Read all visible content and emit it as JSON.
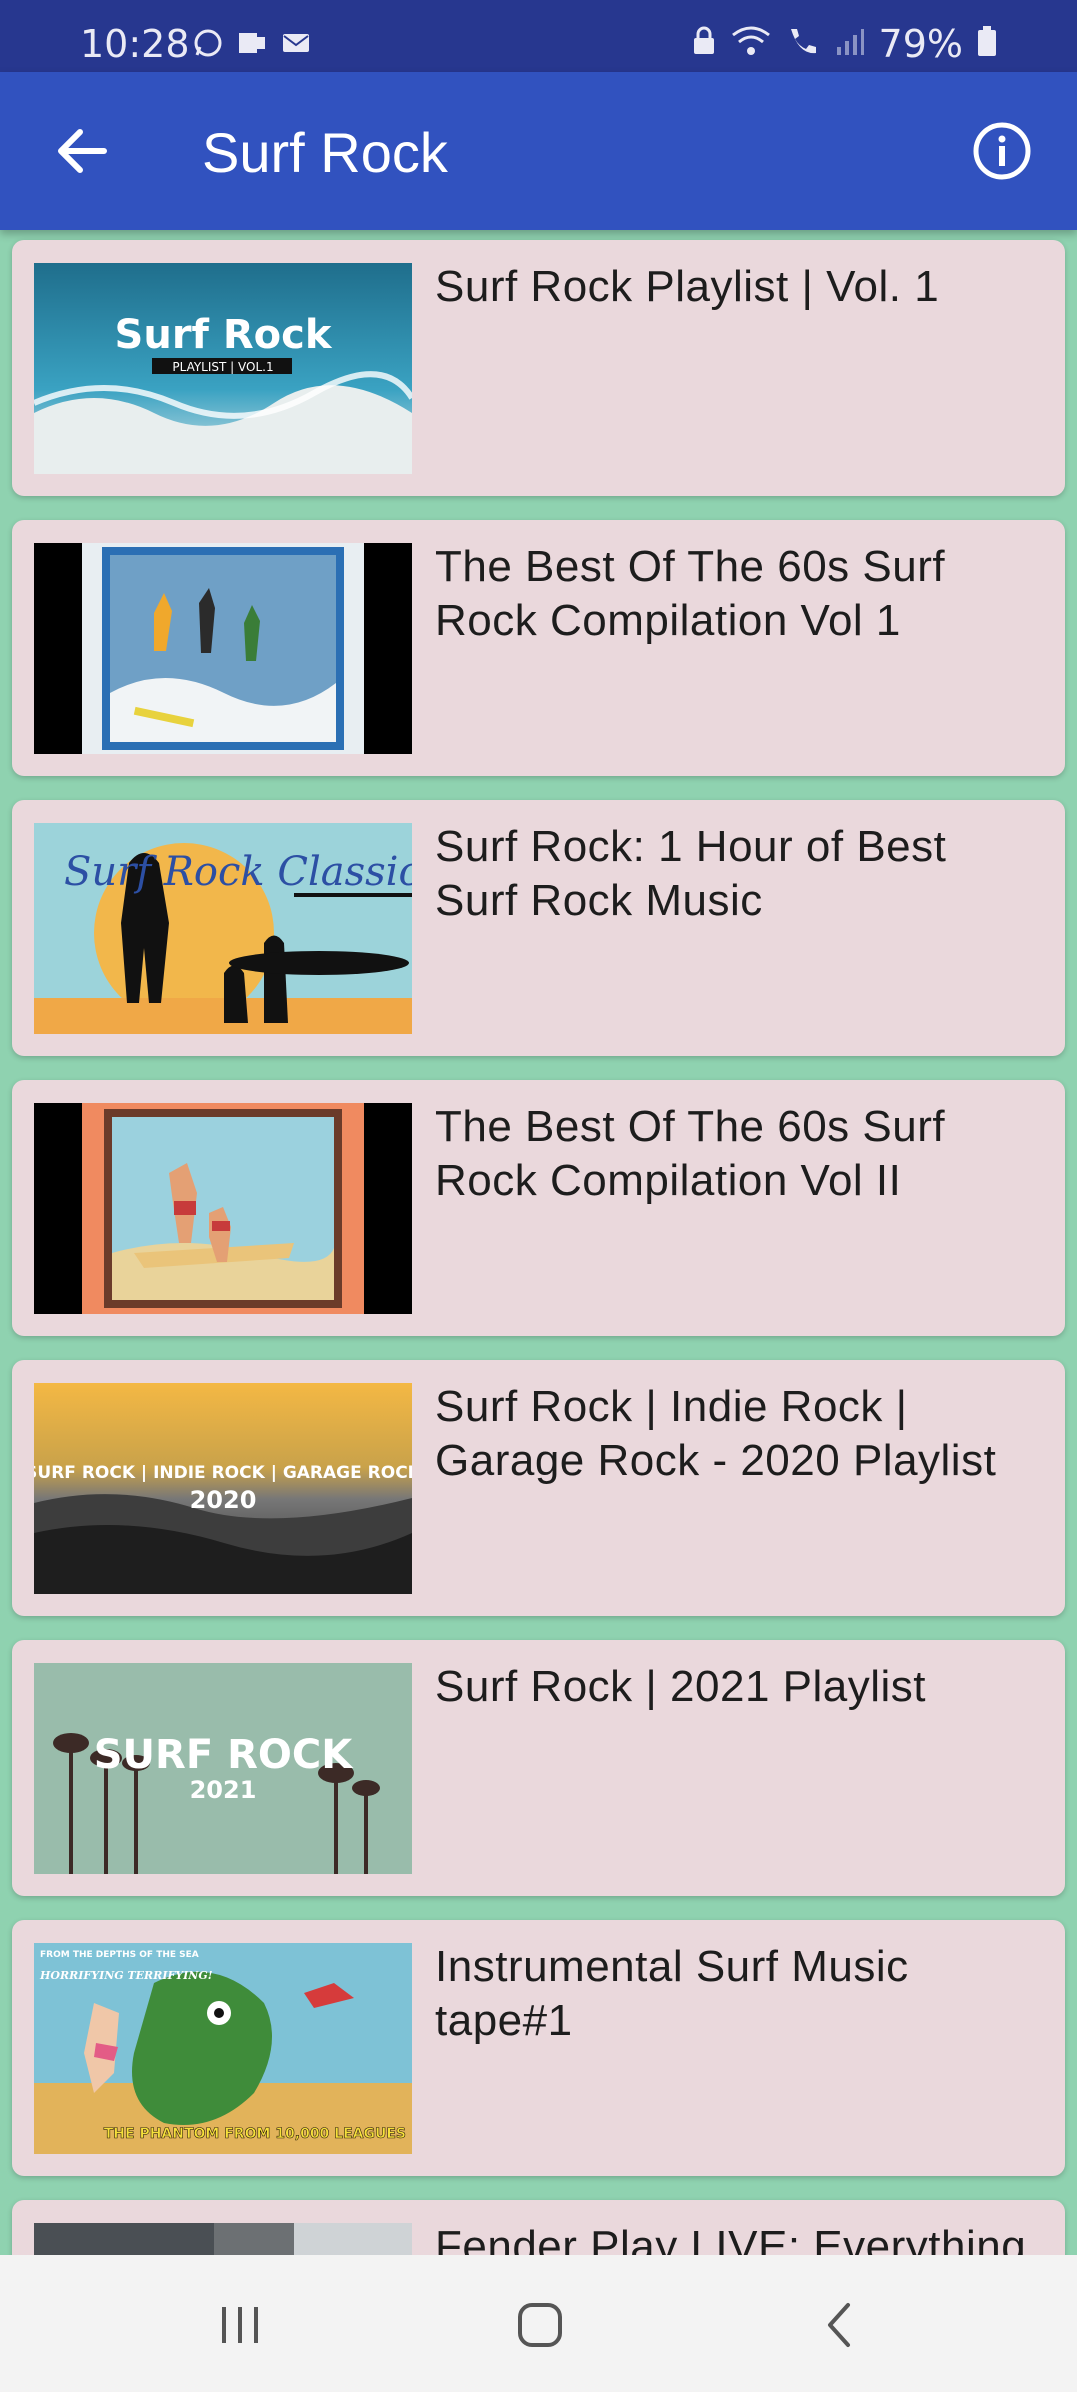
{
  "status": {
    "time": "10:28",
    "battery": "79%"
  },
  "appbar": {
    "title": "Surf Rock",
    "back_icon": "arrow-left-icon",
    "info_icon": "info-icon"
  },
  "items": [
    {
      "title": "Surf Rock Playlist | Vol. 1",
      "thumb_title": "Surf Rock",
      "thumb_sub": "PLAYLIST | VOL.1"
    },
    {
      "title": "The Best Of The 60s Surf Rock Compilation Vol 1"
    },
    {
      "title": "Surf Rock: 1 Hour of Best Surf Rock Music",
      "thumb_title": "Surf Rock Classic"
    },
    {
      "title": "The Best Of The 60s Surf Rock Compilation Vol II"
    },
    {
      "title": "Surf Rock | Indie Rock | Garage Rock - 2020 Playlist",
      "thumb_title": "SURF ROCK | INDIE ROCK | GARAGE ROCK",
      "thumb_sub": "2020"
    },
    {
      "title": "Surf Rock | 2021 Playlist",
      "thumb_title": "SURF ROCK",
      "thumb_sub": "2021"
    },
    {
      "title": "Instrumental Surf Music tape#1",
      "thumb_title": "THE PHANTOM FROM 10,000 LEAGUES",
      "thumb_sub": "HORRIFYING TERRIFYING!",
      "thumb_top": "FROM THE DEPTHS OF THE SEA"
    },
    {
      "title": "Fender Play LIVE: Everything"
    }
  ],
  "nav": {
    "recents_icon": "recents-icon",
    "home_icon": "home-icon",
    "back_icon": "back-chevron-icon"
  }
}
